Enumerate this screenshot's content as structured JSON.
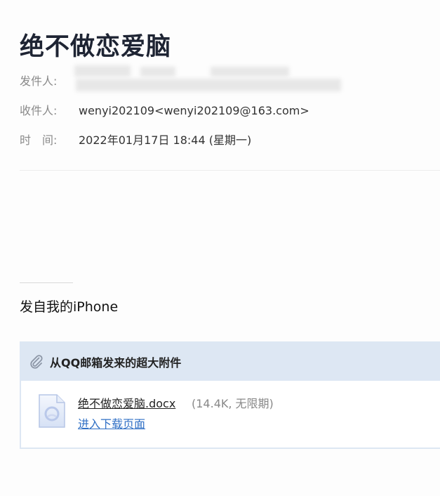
{
  "email": {
    "subject": "绝不做恋爱脑",
    "from_label": "发件人:",
    "to_label": "收件人:",
    "time_label": "时　间:",
    "to_value": "wenyi202109<wenyi202109@163.com>",
    "time_value": "2022年01月17日 18:44 (星期一)",
    "body_signature": "发自我的iPhone"
  },
  "attachment_panel": {
    "header": "从QQ邮箱发来的超大附件",
    "header_icon": "paperclip-icon",
    "file": {
      "icon": "document-icon",
      "name": "绝不做恋爱脑.docx",
      "meta": "(14.4K, 无限期)",
      "download_label": "进入下载页面"
    }
  },
  "colors": {
    "link": "#2f6fc5",
    "panel_header_bg": "#dde7f3",
    "subject": "#1e2433"
  }
}
